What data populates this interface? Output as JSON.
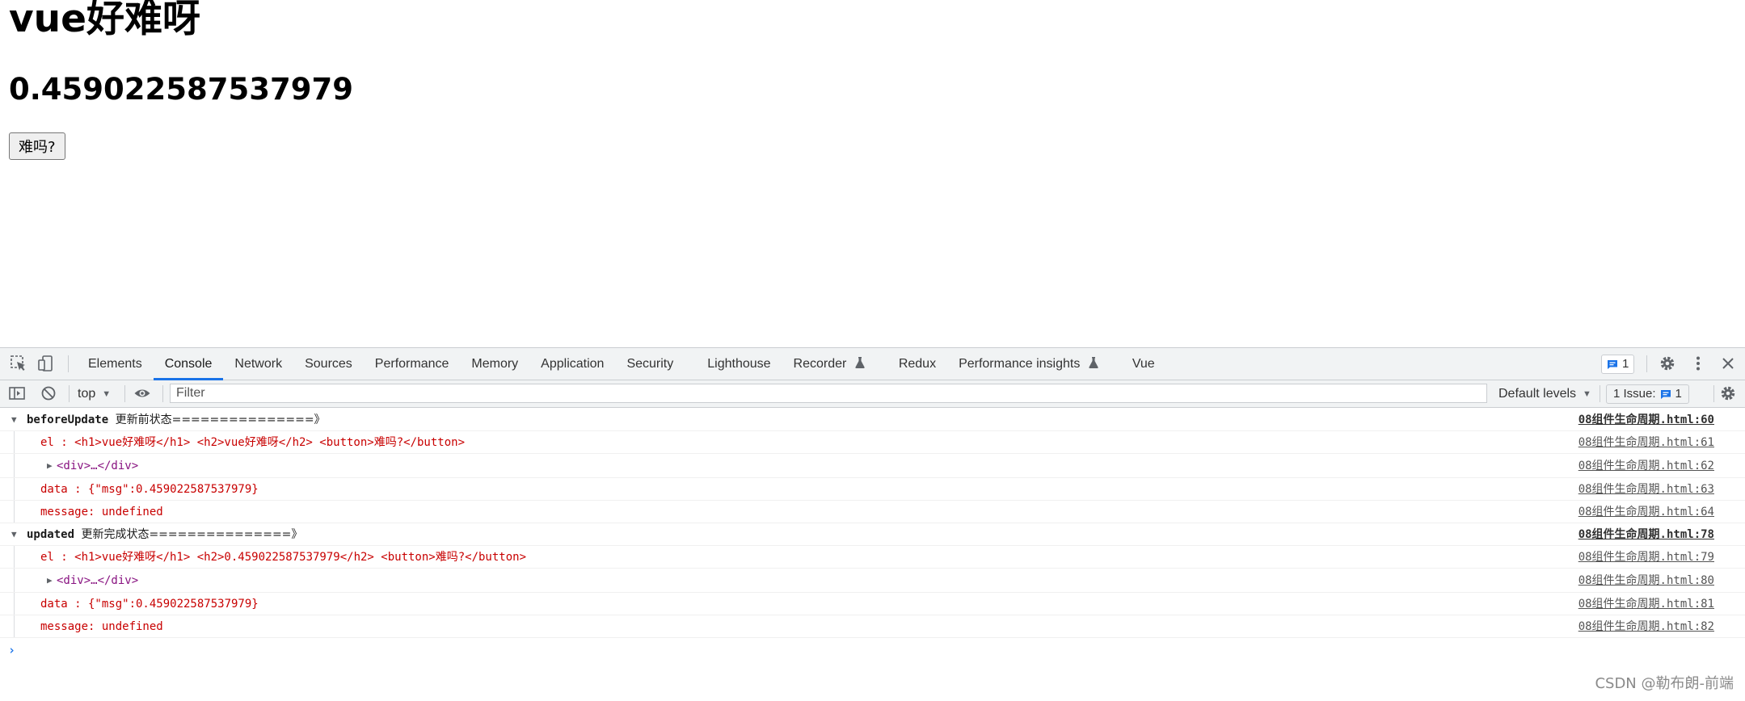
{
  "page": {
    "heading": "vue好难呀",
    "random_value": "0.459022587537979",
    "button_label": "难吗?"
  },
  "devtools": {
    "tabs": [
      {
        "label": "Elements"
      },
      {
        "label": "Console"
      },
      {
        "label": "Network"
      },
      {
        "label": "Sources"
      },
      {
        "label": "Performance"
      },
      {
        "label": "Memory"
      },
      {
        "label": "Application"
      },
      {
        "label": "Security"
      },
      {
        "label": "Lighthouse"
      },
      {
        "label": "Recorder"
      },
      {
        "label": "Redux"
      },
      {
        "label": "Performance insights"
      },
      {
        "label": "Vue"
      }
    ],
    "active_tab": "Console",
    "issue_badge_count": "1",
    "context": "top",
    "filter_placeholder": "Filter",
    "levels_label": "Default levels",
    "issues_label": "1 Issue:",
    "issues_count": "1",
    "console": [
      {
        "kind": "group",
        "hook": "beforeUpdate",
        "text": "更新前状态===============》",
        "src": "08组件生命周期.html:60"
      },
      {
        "kind": "log",
        "text": "el : <h1>vue好难呀</h1> <h2>vue好难呀</h2> <button>难吗?</button>",
        "src": "08组件生命周期.html:61"
      },
      {
        "kind": "tree",
        "text": "<div>…</div>",
        "src": "08组件生命周期.html:62"
      },
      {
        "kind": "log",
        "text": "data : {\"msg\":0.459022587537979}",
        "src": "08组件生命周期.html:63"
      },
      {
        "kind": "log",
        "text": "message: undefined",
        "src": "08组件生命周期.html:64"
      },
      {
        "kind": "group",
        "hook": "updated",
        "text": "更新完成状态===============》",
        "src": "08组件生命周期.html:78"
      },
      {
        "kind": "log",
        "text": "el : <h1>vue好难呀</h1> <h2>0.459022587537979</h2> <button>难吗?</button>",
        "src": "08组件生命周期.html:79"
      },
      {
        "kind": "tree",
        "text": "<div>…</div>",
        "src": "08组件生命周期.html:80"
      },
      {
        "kind": "log",
        "text": "data : {\"msg\":0.459022587537979}",
        "src": "08组件生命周期.html:81"
      },
      {
        "kind": "log",
        "text": "message: undefined",
        "src": "08组件生命周期.html:82"
      }
    ],
    "prompt_glyph": "›"
  },
  "watermark": "CSDN @勒布朗-前端",
  "colors": {
    "accent": "#1a73e8",
    "error_red": "#c80000",
    "tag_purple": "#881280",
    "toolbar_bg": "#f1f3f4"
  }
}
